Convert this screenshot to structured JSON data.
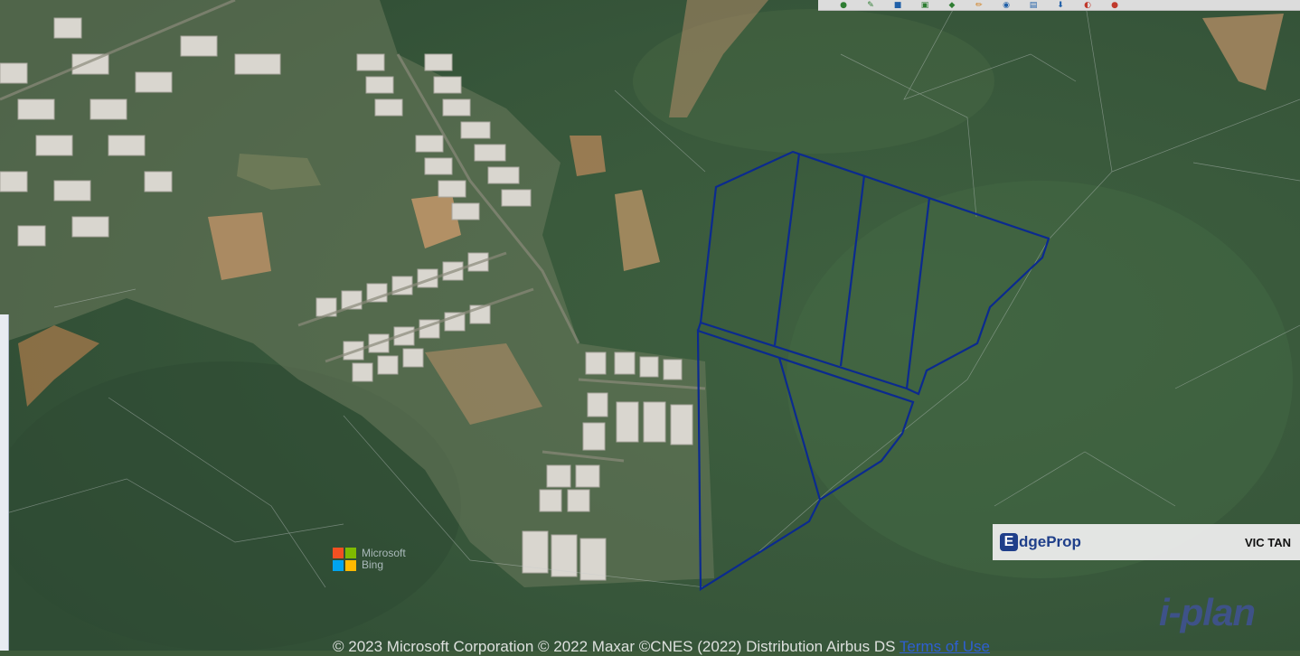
{
  "map": {
    "type": "satellite-imagery",
    "overlay_color": "#0b2a8f",
    "lot_count": 6
  },
  "toolbar": {
    "buttons": [
      {
        "icon": "zoom-in-icon"
      },
      {
        "icon": "measure-icon"
      },
      {
        "icon": "layer-icon"
      },
      {
        "icon": "select-icon"
      },
      {
        "icon": "clear-icon"
      },
      {
        "icon": "draw-icon"
      },
      {
        "icon": "identify-icon"
      },
      {
        "icon": "print-icon"
      },
      {
        "icon": "download-icon"
      },
      {
        "icon": "share-icon"
      },
      {
        "icon": "help-icon"
      }
    ]
  },
  "bing": {
    "line1": "Microsoft",
    "line2": "Bing",
    "colors": [
      "#f25022",
      "#7fba00",
      "#00a4ef",
      "#ffb900"
    ]
  },
  "edgeprop": {
    "logo_mark": "E",
    "logo_rest": "dgeProp",
    "agent_name": "VIC TAN"
  },
  "watermark": {
    "text": "i-plan"
  },
  "attribution": {
    "text": "© 2023 Microsoft Corporation © 2022 Maxar ©CNES (2022) Distribution Airbus DS",
    "terms_link": "Terms of Use"
  }
}
